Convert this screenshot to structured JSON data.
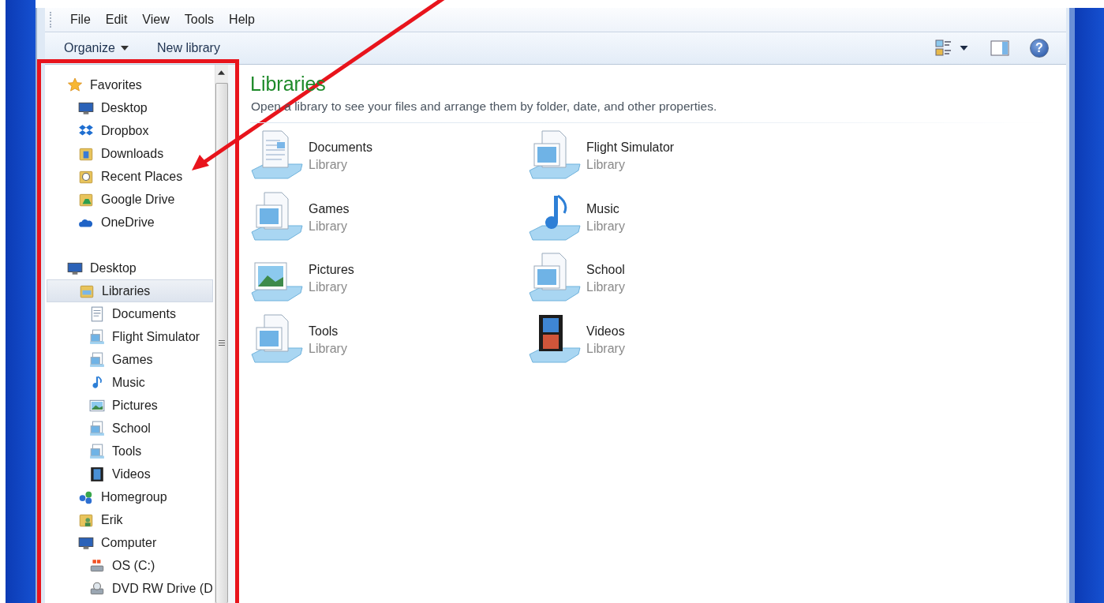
{
  "menu": [
    {
      "label": "File"
    },
    {
      "label": "Edit"
    },
    {
      "label": "View"
    },
    {
      "label": "Tools"
    },
    {
      "label": "Help"
    }
  ],
  "toolbar": {
    "buttons": [
      {
        "label": "Organize",
        "dropdown": true
      },
      {
        "label": "New library",
        "dropdown": false
      }
    ],
    "help": "?"
  },
  "nav": [
    {
      "label": "Favorites",
      "kind": "star",
      "selected": false,
      "children": [
        {
          "label": "Desktop",
          "kind": "desktop",
          "selected": false
        },
        {
          "label": "Dropbox",
          "kind": "dropbox",
          "selected": false
        },
        {
          "label": "Downloads",
          "kind": "downloads",
          "selected": false
        },
        {
          "label": "Recent Places",
          "kind": "recent",
          "selected": false
        },
        {
          "label": "Google Drive",
          "kind": "gdrive",
          "selected": false
        },
        {
          "label": "OneDrive",
          "kind": "cloud",
          "selected": false
        }
      ]
    },
    {
      "label": "Desktop",
      "kind": "desktop",
      "selected": false,
      "children": [
        {
          "label": "Libraries",
          "kind": "libraries",
          "selected": true,
          "children": [
            {
              "label": "Documents",
              "kind": "document",
              "selected": false
            },
            {
              "label": "Flight Simulator",
              "kind": "library",
              "selected": false
            },
            {
              "label": "Games",
              "kind": "library",
              "selected": false
            },
            {
              "label": "Music",
              "kind": "music",
              "selected": false
            },
            {
              "label": "Pictures",
              "kind": "pictures",
              "selected": false
            },
            {
              "label": "School",
              "kind": "library",
              "selected": false
            },
            {
              "label": "Tools",
              "kind": "library",
              "selected": false
            },
            {
              "label": "Videos",
              "kind": "video",
              "selected": false
            }
          ]
        },
        {
          "label": "Homegroup",
          "kind": "homegroup",
          "selected": false
        },
        {
          "label": "Erik",
          "kind": "user",
          "selected": false
        },
        {
          "label": "Computer",
          "kind": "computer",
          "selected": false,
          "children": [
            {
              "label": "OS (C:)",
              "kind": "drive",
              "selected": false
            },
            {
              "label": "DVD RW Drive (D",
              "kind": "dvd",
              "selected": false
            }
          ]
        }
      ]
    }
  ],
  "content": {
    "title": "Libraries",
    "subtitle": "Open a library to see your files and arrange them by folder, date, and other properties.",
    "items": [
      {
        "name": "Documents",
        "type": "Library",
        "kind": "document"
      },
      {
        "name": "Flight Simulator",
        "type": "Library",
        "kind": "library"
      },
      {
        "name": "Games",
        "type": "Library",
        "kind": "library"
      },
      {
        "name": "Music",
        "type": "Library",
        "kind": "music"
      },
      {
        "name": "Pictures",
        "type": "Library",
        "kind": "pictures"
      },
      {
        "name": "School",
        "type": "Library",
        "kind": "library"
      },
      {
        "name": "Tools",
        "type": "Library",
        "kind": "library"
      },
      {
        "name": "Videos",
        "type": "Library",
        "kind": "video"
      }
    ]
  }
}
